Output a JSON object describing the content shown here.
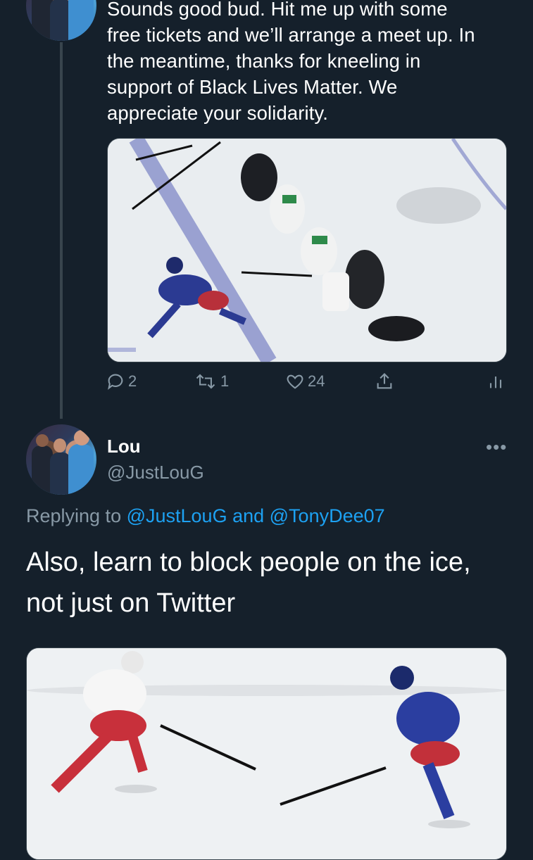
{
  "prev_tweet": {
    "text_lines": [
      "Sounds good bud. Hit me up with some",
      "free tickets and we’ll arrange a meet up. In",
      "the meantime, thanks for kneeling in",
      "support of Black Lives Matter. We",
      "appreciate your solidarity."
    ],
    "actions": {
      "reply_count": "2",
      "retweet_count": "1",
      "like_count": "24"
    }
  },
  "reply_tweet": {
    "name": "Lou",
    "handle": "@JustLouG",
    "replying_prefix": "Replying to ",
    "replying_user1": "@JustLouG",
    "replying_and": " and ",
    "replying_user2": "@TonyDee07",
    "text_lines": [
      "Also, learn to block people on the ice,",
      "not just on Twitter"
    ]
  },
  "icons": {
    "reply": "comment-icon",
    "retweet": "retweet-icon",
    "like": "heart-icon",
    "share": "share-icon",
    "analytics": "analytics-icon",
    "more": "more-icon"
  },
  "colors": {
    "background": "#15202b",
    "text": "#ffffff",
    "secondary": "#8899a6",
    "accent": "#1da1f2"
  }
}
